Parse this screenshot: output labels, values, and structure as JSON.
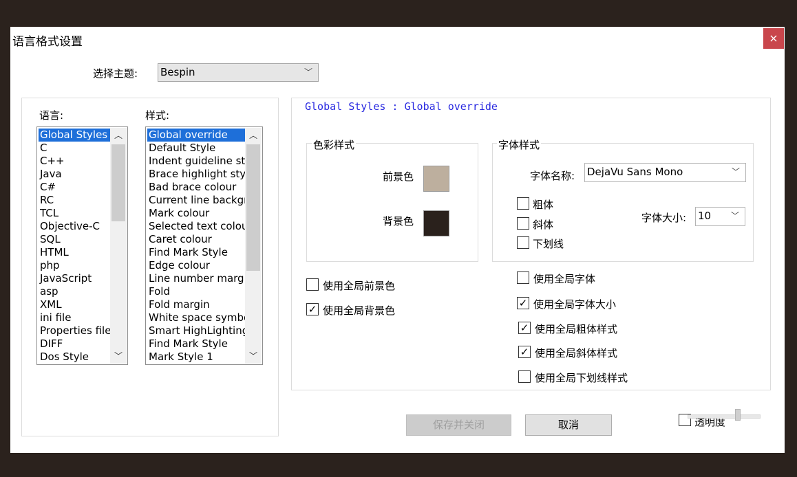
{
  "dialog": {
    "title": "语言格式设置",
    "close": "×"
  },
  "theme": {
    "label": "选择主题:",
    "value": "Bespin"
  },
  "languages": {
    "label": "语言:",
    "items": [
      "Global Styles",
      "C",
      "C++",
      "Java",
      "C#",
      "RC",
      "TCL",
      "Objective-C",
      "SQL",
      "HTML",
      "php",
      "JavaScript",
      "asp",
      "XML",
      "ini file",
      "Properties file",
      "DIFF",
      "Dos Style"
    ],
    "selected": "Global Styles"
  },
  "styles": {
    "label": "样式:",
    "items": [
      "Global override",
      "Default Style",
      "Indent guideline sty",
      "Brace highlight style",
      "Bad brace colour",
      "Current line backgro",
      "Mark colour",
      "Selected text colour",
      "Caret colour",
      "Find Mark Style",
      "Edge colour",
      "Line number margi",
      "Fold",
      "Fold margin",
      "White space symbol",
      "Smart HighLighting",
      "Find Mark Style",
      "Mark Style 1"
    ],
    "selected": "Global override"
  },
  "style_heading": "Global Styles : Global override",
  "color_style": {
    "group_label": "色彩样式",
    "foreground_label": "前景色",
    "foreground_color": "#bdaf9e",
    "background_label": "背景色",
    "background_color": "#2a211c"
  },
  "font_style": {
    "group_label": "字体样式",
    "font_name_label": "字体名称:",
    "font_name": "DejaVu Sans Mono",
    "bold_label": "粗体",
    "italic_label": "斜体",
    "underline_label": "下划线",
    "size_label": "字体大小:",
    "size": "10"
  },
  "options": {
    "use_global_fg": {
      "label": "使用全局前景色",
      "checked": false
    },
    "use_global_bg": {
      "label": "使用全局背景色",
      "checked": true
    },
    "use_global_font": {
      "label": "使用全局字体",
      "checked": false
    },
    "use_global_font_size": {
      "label": "使用全局字体大小",
      "checked": true
    },
    "use_global_bold": {
      "label": "使用全局粗体样式",
      "checked": true
    },
    "use_global_italic": {
      "label": "使用全局斜体样式",
      "checked": true
    },
    "use_global_underline": {
      "label": "使用全局下划线样式",
      "checked": false
    }
  },
  "buttons": {
    "save_close": "保存并关闭",
    "cancel": "取消"
  },
  "transparency": {
    "label": "透明度",
    "checked": false
  },
  "icons": {
    "dropdown": "chevron-down-icon",
    "check": "checkmark-icon"
  }
}
